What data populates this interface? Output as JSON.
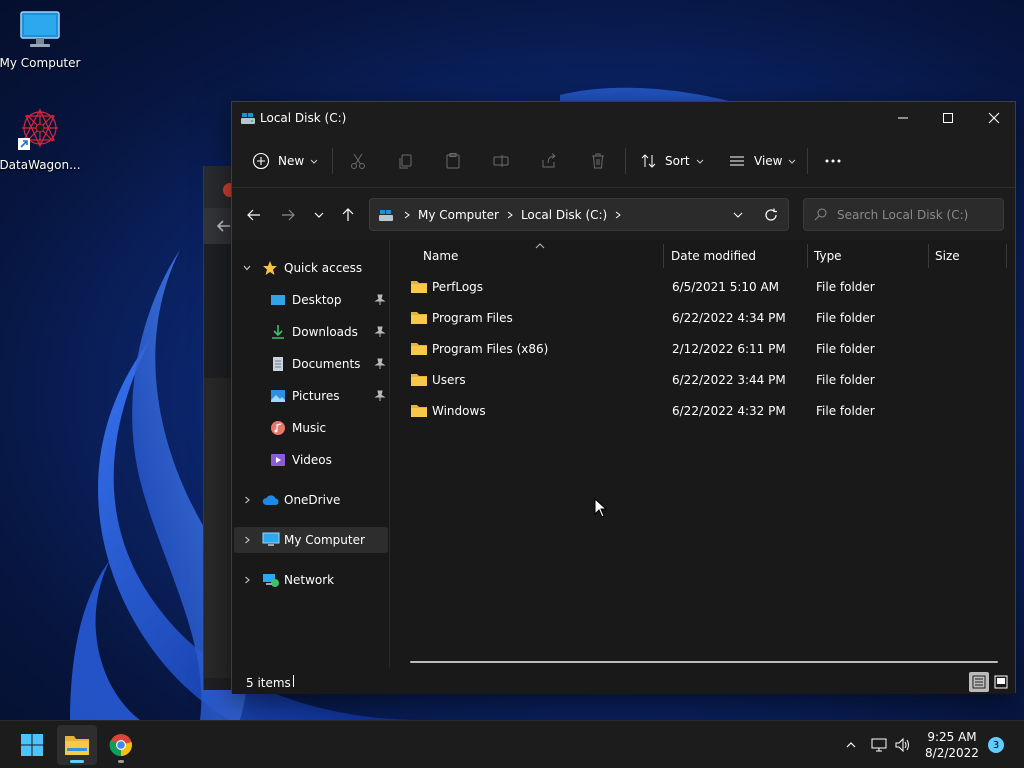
{
  "desktop": {
    "icons": [
      {
        "label": "My Computer",
        "icon": "monitor-icon"
      },
      {
        "label": "DataWagon...",
        "icon": "datawagon-shortcut-icon"
      }
    ]
  },
  "window": {
    "title": "Local Disk (C:)",
    "controls": [
      "minimize-icon",
      "maximize-icon",
      "close-icon"
    ]
  },
  "toolbar": {
    "new_label": "New",
    "sort_label": "Sort",
    "view_label": "View"
  },
  "address": {
    "crumbs": [
      "My Computer",
      "Local Disk (C:)"
    ],
    "search_placeholder": "Search Local Disk (C:)"
  },
  "nav": {
    "quick_access": "Quick access",
    "items": [
      {
        "label": "Desktop",
        "icon": "desktop-icon",
        "pinned": true
      },
      {
        "label": "Downloads",
        "icon": "downloads-icon",
        "pinned": true
      },
      {
        "label": "Documents",
        "icon": "documents-icon",
        "pinned": true
      },
      {
        "label": "Pictures",
        "icon": "pictures-icon",
        "pinned": true
      },
      {
        "label": "Music",
        "icon": "music-icon",
        "pinned": false
      },
      {
        "label": "Videos",
        "icon": "videos-icon",
        "pinned": false
      }
    ],
    "onedrive": "OneDrive",
    "my_computer": "My Computer",
    "network": "Network"
  },
  "list": {
    "columns": [
      "Name",
      "Date modified",
      "Type",
      "Size"
    ],
    "rows": [
      {
        "name": "PerfLogs",
        "date": "6/5/2021 5:10 AM",
        "type": "File folder"
      },
      {
        "name": "Program Files",
        "date": "6/22/2022 4:34 PM",
        "type": "File folder"
      },
      {
        "name": "Program Files (x86)",
        "date": "2/12/2022 6:11 PM",
        "type": "File folder"
      },
      {
        "name": "Users",
        "date": "6/22/2022 3:44 PM",
        "type": "File folder"
      },
      {
        "name": "Windows",
        "date": "6/22/2022 4:32 PM",
        "type": "File folder"
      }
    ]
  },
  "status": {
    "count": "5 items"
  },
  "taskbar": {
    "time": "9:25 AM",
    "date": "8/2/2022",
    "notifications": "3"
  },
  "colors": {
    "accent": "#60cdff",
    "folder": "#f8c948",
    "window_bg": "#191919"
  }
}
